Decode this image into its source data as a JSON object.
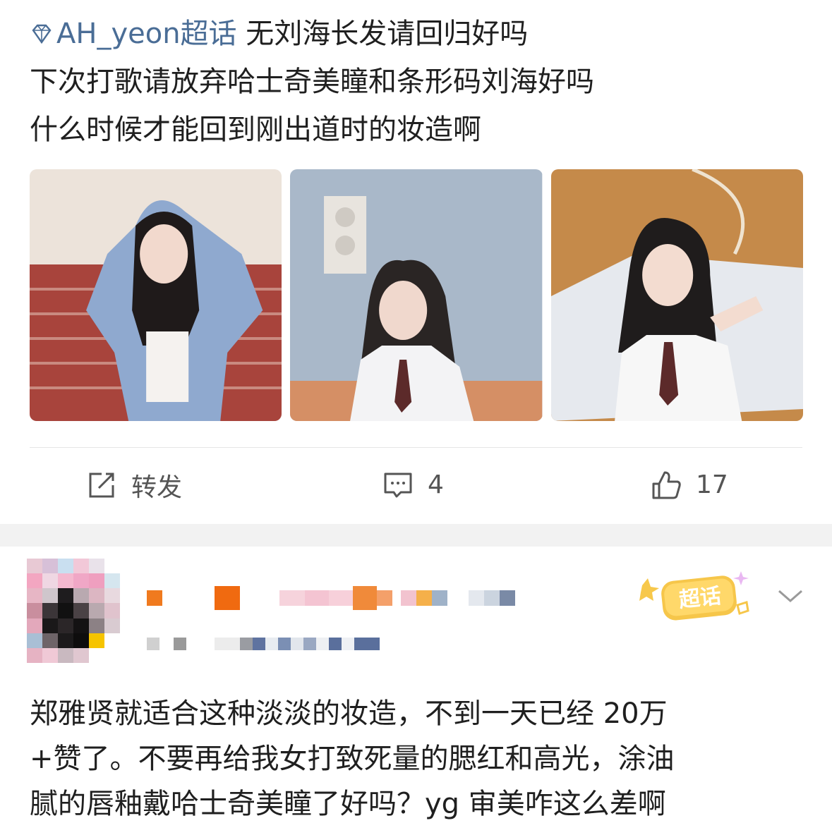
{
  "post": {
    "topic": "AH_yeon超话",
    "line1_rest": " 无刘海长发请回归好吗",
    "line2": "下次打歌请放弃哈士奇美瞳和条形码刘海好吗",
    "line3": "什么时候才能回到刚出道时的妆造啊"
  },
  "actions": {
    "repost_label": "转发",
    "comment_count": "4",
    "like_count": "17"
  },
  "comment": {
    "badge_text": "超话",
    "text_line1": "郑雅贤就适合这种淡淡的妆造，不到一天已经 20万",
    "text_line2": "+赞了。不要再给我女打致死量的腮红和高光，涂油",
    "text_line3": "腻的唇釉戴哈士奇美瞳了好吗？yg 审美咋这么差啊"
  },
  "colors": {
    "topic_blue": "#4a6d96",
    "icon_gray": "#555555",
    "band_gray": "#f2f2f2"
  },
  "icons": [
    "diamond-icon",
    "repost-icon",
    "comment-icon",
    "like-icon",
    "chevron-down-icon"
  ]
}
